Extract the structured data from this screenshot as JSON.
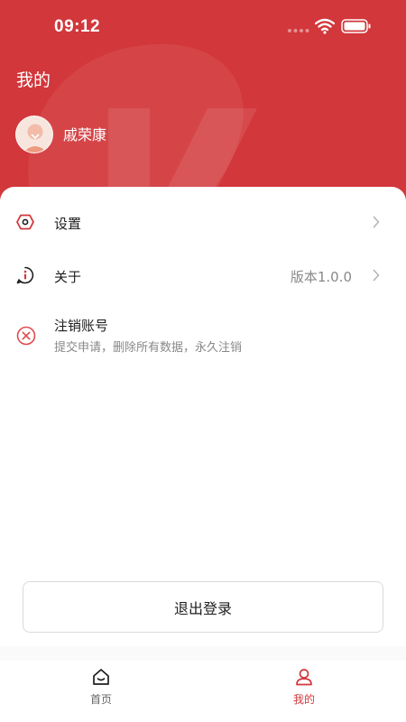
{
  "status_bar": {
    "time": "09:12"
  },
  "header": {
    "title": "我的",
    "user_name": "戚荣康"
  },
  "menu": [
    {
      "label": "设置",
      "icon": "hexagon-settings-icon"
    },
    {
      "label": "关于",
      "value": "版本1.0.0",
      "icon": "info-circle-icon"
    },
    {
      "label": "注销账号",
      "subtitle": "提交申请，删除所有数据，永久注销",
      "icon": "close-circle-icon"
    }
  ],
  "logout_label": "退出登录",
  "tabs": [
    {
      "label": "首页",
      "icon": "home-icon",
      "active": false
    },
    {
      "label": "我的",
      "icon": "user-icon",
      "active": true
    }
  ],
  "colors": {
    "brand": "#d2373b",
    "danger": "#e0494b",
    "inactive": "#666666",
    "muted": "#888888"
  }
}
